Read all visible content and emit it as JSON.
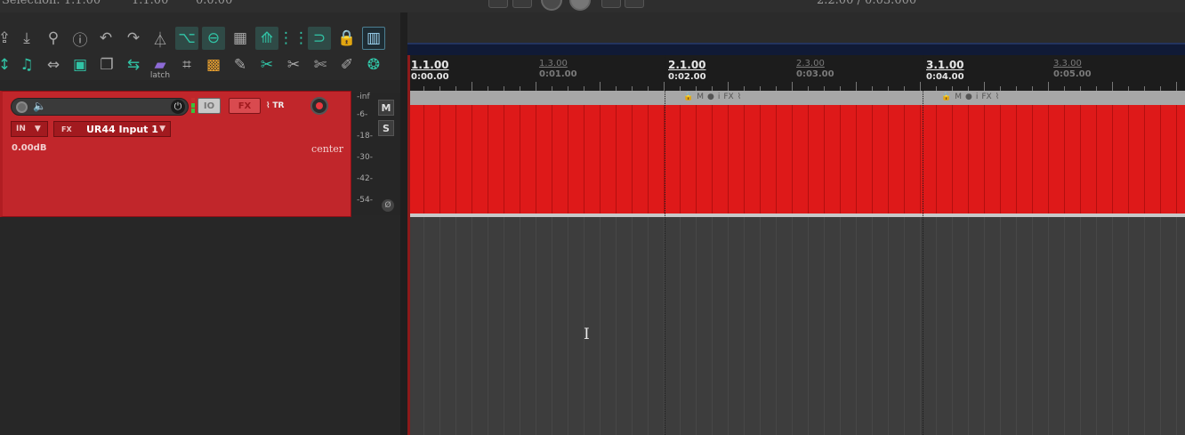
{
  "topbar": {
    "selection_label": "Selection: 1.1.00",
    "sel_end": "1.1.00",
    "sel_len": "0.0.00",
    "position": "2.2.00 / 0:03.000"
  },
  "toolbar": {
    "row1_icons": [
      "metronome-icon",
      "import-icon",
      "media-explorer-icon",
      "info-icon",
      "undo-icon",
      "redo-icon",
      "metronome-toggle-icon",
      "ripple-icon",
      "link-icon",
      "grid-icon",
      "auto-crossfade-icon",
      "snap-grid-icon",
      "snap-magnet-icon",
      "lock-icon",
      "envelope-panel-icon"
    ],
    "row2_icons": [
      "move-icon",
      "split-icon",
      "glue-icon",
      "paste-icon",
      "copy-icon",
      "trim-icon",
      "latch-icon",
      "grid-snap-icon",
      "color-icon",
      "pencil-icon",
      "cut-icon",
      "cut-alt-icon",
      "scissors-icon",
      "marker-icon",
      "fx-icon"
    ],
    "latch_label": "latch"
  },
  "track": {
    "io_label": "IO",
    "fx_label": "FX",
    "env_label": "TR",
    "in_label": "IN",
    "fx_small": "FX",
    "input_name": "UR44 Input 1",
    "volume": "0.00dB",
    "pan": "center",
    "accent_color": "#c1262b"
  },
  "meter": {
    "labels": [
      "-inf",
      "-6-",
      "-18-",
      "-30-",
      "-42-",
      "-54-"
    ],
    "mute_label": "M",
    "solo_label": "S",
    "phase_label": "Ø"
  },
  "ruler": {
    "marks": [
      {
        "measure": "1.1.00",
        "time": "0:00.00",
        "major": true
      },
      {
        "measure": "1.3.00",
        "time": "0:01.00",
        "major": false
      },
      {
        "measure": "2.1.00",
        "time": "0:02.00",
        "major": true
      },
      {
        "measure": "2.3.00",
        "time": "0:03.00",
        "major": false
      },
      {
        "measure": "3.1.00",
        "time": "0:04.00",
        "major": true
      },
      {
        "measure": "3.3.00",
        "time": "0:05.00",
        "major": false
      }
    ]
  },
  "item_header": {
    "buttons": [
      "M",
      "i",
      "FX"
    ]
  },
  "colors": {
    "item_red": "#de1919",
    "background": "#2b2b2b",
    "toolbar_active": "#31c4a6"
  }
}
